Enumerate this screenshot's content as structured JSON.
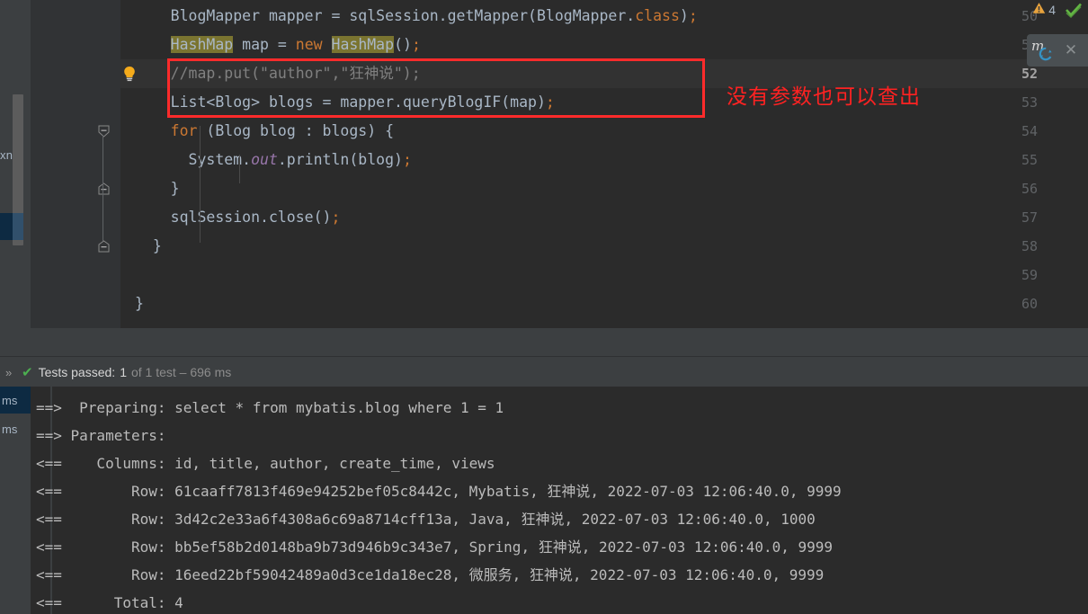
{
  "editor": {
    "lines": [
      {
        "num": "50",
        "indent": 4,
        "current": false,
        "tokens": [
          {
            "t": "BlogMapper mapper = sqlSession.getMapper(BlogMapper.",
            "c": "k-ident"
          },
          {
            "t": "class",
            "c": "k-kw"
          },
          {
            "t": ")",
            "c": "k-ident"
          },
          {
            "t": ";",
            "c": "k-punct"
          }
        ]
      },
      {
        "num": "51",
        "indent": 4,
        "current": false,
        "tokens": [
          {
            "t": "HashMap",
            "c": "k-ident",
            "hl": "search"
          },
          {
            "t": " map = ",
            "c": "k-ident"
          },
          {
            "t": "new",
            "c": "k-kw"
          },
          {
            "t": " ",
            "c": "k-ident"
          },
          {
            "t": "HashMap",
            "c": "k-ident",
            "hl": "search"
          },
          {
            "t": "()",
            "c": "k-ident"
          },
          {
            "t": ";",
            "c": "k-punct"
          }
        ]
      },
      {
        "num": "52",
        "indent": 4,
        "current": true,
        "tokens": [
          {
            "t": "//map.put(\"author\",\"狂神说\");",
            "c": "k-cmt"
          }
        ]
      },
      {
        "num": "53",
        "indent": 4,
        "current": false,
        "tokens": [
          {
            "t": "List<Blog> blogs = mapper.queryBlogIF(map)",
            "c": "k-ident"
          },
          {
            "t": ";",
            "c": "k-punct"
          }
        ]
      },
      {
        "num": "54",
        "indent": 4,
        "current": false,
        "tokens": [
          {
            "t": "for",
            "c": "k-kw"
          },
          {
            "t": " (Blog blog : blogs) {",
            "c": "k-ident"
          }
        ]
      },
      {
        "num": "55",
        "indent": 6,
        "current": false,
        "tokens": [
          {
            "t": "System.",
            "c": "k-ident"
          },
          {
            "t": "out",
            "c": "k-field"
          },
          {
            "t": ".println(blog)",
            "c": "k-ident"
          },
          {
            "t": ";",
            "c": "k-punct"
          }
        ]
      },
      {
        "num": "56",
        "indent": 4,
        "current": false,
        "tokens": [
          {
            "t": "}",
            "c": "k-ident"
          }
        ]
      },
      {
        "num": "57",
        "indent": 4,
        "current": false,
        "tokens": [
          {
            "t": "sqlSession.close()",
            "c": "k-ident"
          },
          {
            "t": ";",
            "c": "k-punct"
          }
        ]
      },
      {
        "num": "58",
        "indent": 2,
        "current": false,
        "tokens": [
          {
            "t": "}",
            "c": "k-ident"
          }
        ]
      },
      {
        "num": "59",
        "indent": 0,
        "current": false,
        "tokens": []
      },
      {
        "num": "60",
        "indent": 0,
        "current": false,
        "tokens": [
          {
            "t": "}",
            "c": "k-ident"
          }
        ]
      }
    ],
    "far_left_label": "xn",
    "bulb_icon": "lightbulb-icon",
    "annotation": {
      "text": "没有参数也可以查出",
      "color": "#ff2222",
      "box_color": "#ff2b2b"
    },
    "inspection": {
      "warning_count": "4",
      "warning_icon": "warning-triangle-icon",
      "ok_icon": "checkmark-icon"
    },
    "mybatis_widget": {
      "icon": "mybatis-refresh-icon",
      "close_label": "✕"
    }
  },
  "test_bar": {
    "expand_label": "»",
    "status_icon": "green-check-icon",
    "label": "Tests passed:",
    "count": "1",
    "of_text": "of 1 test – 696 ms"
  },
  "console": {
    "tree_rows": [
      {
        "label": "ms",
        "selected": true
      },
      {
        "label": "ms",
        "selected": false
      }
    ],
    "lines": [
      {
        "text": "==>  Preparing: select * from mybatis.blog where 1 = 1"
      },
      {
        "text": "==> Parameters: "
      },
      {
        "text": "<==    Columns: id, title, author, create_time, views"
      },
      {
        "text": "<==        Row: 61caaff7813f469e94252bef05c8442c, Mybatis, 狂神说, 2022-07-03 12:06:40.0, 9999"
      },
      {
        "text": "<==        Row: 3d42c2e33a6f4308a6c69a8714cff13a, Java, 狂神说, 2022-07-03 12:06:40.0, 1000"
      },
      {
        "text": "<==        Row: bb5ef58b2d0148ba9b73d946b9c343e7, Spring, 狂神说, 2022-07-03 12:06:40.0, 9999"
      },
      {
        "text": "<==        Row: 16eed22bf59042489a0d3ce1da18ec28, 微服务, 狂神说, 2022-07-03 12:06:40.0, 9999"
      },
      {
        "text": "<==      Total: 4"
      }
    ]
  }
}
